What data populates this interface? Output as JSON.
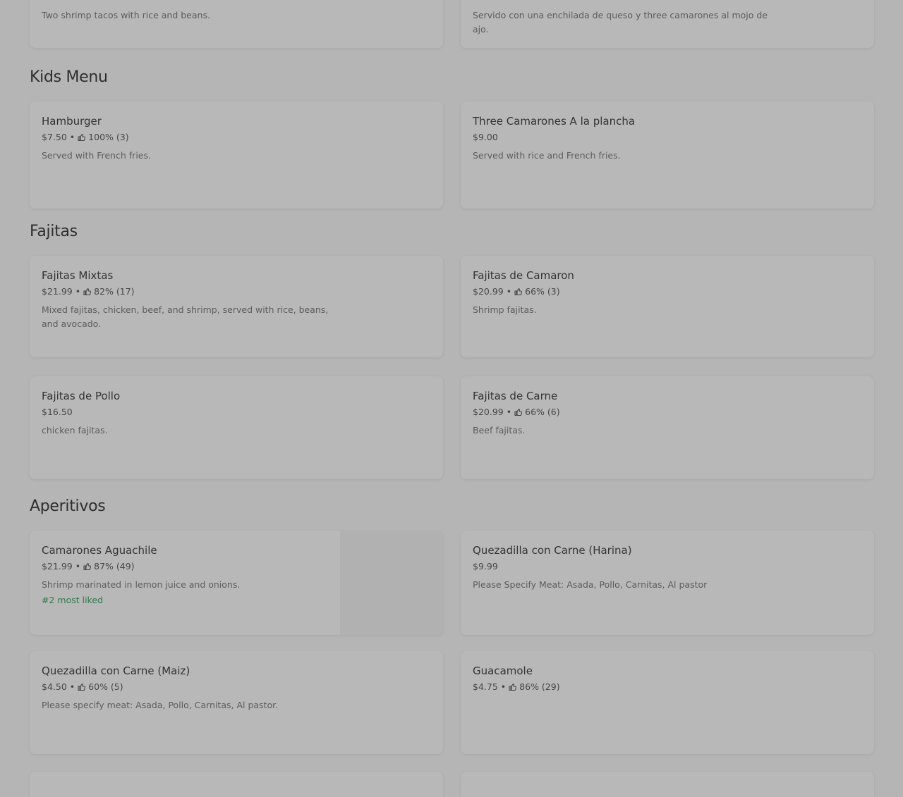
{
  "top_cards": {
    "left_desc": "Two shrimp tacos with rice and beans.",
    "right_desc": "Servido con una enchilada de queso y three camarones al mojo de ajo."
  },
  "sections": {
    "kids": {
      "title": "Kids Menu",
      "items": [
        {
          "name": "Hamburger",
          "price": "$7.50",
          "rating": "100% (3)",
          "desc": "Served with French fries."
        },
        {
          "name": "Three Camarones A la plancha",
          "price": "$9.00",
          "desc": "Served with rice and French fries."
        }
      ]
    },
    "fajitas": {
      "title": "Fajitas",
      "items": [
        {
          "name": "Fajitas Mixtas",
          "price": "$21.99",
          "rating": "82% (17)",
          "desc": "Mixed fajitas, chicken, beef, and shrimp, served with rice, beans, and avocado."
        },
        {
          "name": "Fajitas de Camaron",
          "price": "$20.99",
          "rating": "66% (3)",
          "desc": "Shrimp fajitas."
        },
        {
          "name": "Fajitas de Pollo",
          "price": "$16.50",
          "desc": "chicken fajitas."
        },
        {
          "name": "Fajitas de Carne",
          "price": "$20.99",
          "rating": "66% (6)",
          "desc": "Beef fajitas."
        }
      ]
    },
    "aperitivos": {
      "title": "Aperitivos",
      "items": [
        {
          "name": "Camarones Aguachile",
          "price": "$21.99",
          "rating": "87% (49)",
          "desc": "Shrimp marinated in lemon juice and onions.",
          "badge": "#2 most liked"
        },
        {
          "name": "Quezadilla con Carne (Harina)",
          "price": "$9.99",
          "desc": "Please Specify Meat: Asada, Pollo, Carnitas, Al pastor"
        },
        {
          "name": "Quezadilla con Carne (Maiz)",
          "price": "$4.50",
          "rating": "60% (5)",
          "desc": "Please specify meat: Asada, Pollo, Carnitas, Al pastor."
        },
        {
          "name": "Guacamole",
          "price": "$4.75",
          "rating": "86% (29)"
        }
      ]
    }
  },
  "separator": "•",
  "icons": {
    "rating": "thumbs-up-icon"
  },
  "colors": {
    "badge": "#2f7a4a"
  }
}
